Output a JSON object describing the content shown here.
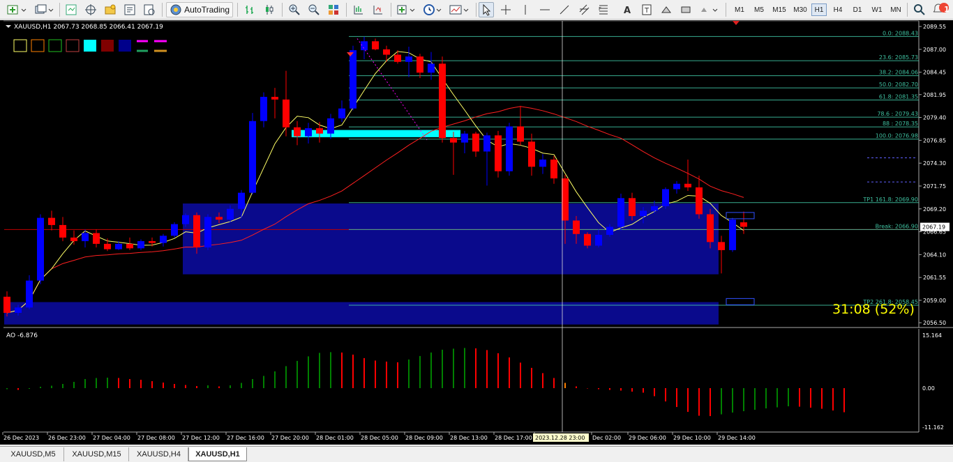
{
  "toolbar": {
    "autotrading_label": "AutoTrading",
    "timeframes": [
      "M1",
      "M5",
      "M15",
      "M30",
      "H1",
      "H4",
      "D1",
      "W1",
      "MN"
    ],
    "active_timeframe": "H1",
    "notification_count": "1"
  },
  "chart": {
    "header": "XAUUSD,H1  2067.73 2068.85 2066.41 2067.19",
    "current_price": "2067.19",
    "price_labels": [
      "2089.55",
      "2087.00",
      "2084.45",
      "2081.95",
      "2079.40",
      "2076.85",
      "2074.30",
      "2071.75",
      "2069.20",
      "2066.65",
      "2064.10",
      "2061.55",
      "2059.00",
      "2056.50"
    ],
    "fib_labels": [
      "0.0: 2088.43",
      "23.6: 2085.73",
      "38.2: 2084.06",
      "50.0: 2082.70",
      "61.8: 2081.35",
      "78.6 : 2079.43",
      "88 : 2078.35",
      "100.0: 2076.98",
      "TP1 161.8: 2069.90",
      "Break: 2066.90",
      "TP2 261.8: 2058.45"
    ],
    "countdown": "31:08 (52%)",
    "time_labels": [
      "26 Dec 2023",
      "26 Dec 23:00",
      "27 Dec 04:00",
      "27 Dec 08:00",
      "27 Dec 12:00",
      "27 Dec 16:00",
      "27 Dec 20:00",
      "28 Dec 01:00",
      "28 Dec 05:00",
      "28 Dec 09:00",
      "28 Dec 13:00",
      "28 Dec 17:00",
      "2023.12.28 23:00",
      "Dec 02:00",
      "29 Dec 06:00",
      "29 Dec 10:00",
      "29 Dec 14:00"
    ],
    "colors": {
      "bull": "#0000ff",
      "bear": "#ff0000",
      "zone": "#0a0a8c",
      "ma_fast": "#ffff66",
      "ma_slow": "#ff2020",
      "fib": "#3fc0a0",
      "cyan_zone": "#00ffff"
    },
    "candles": [
      {
        "o": 2059.4,
        "h": 2060.0,
        "l": 2057.2,
        "c": 2057.6
      },
      {
        "o": 2057.6,
        "h": 2058.5,
        "l": 2057.3,
        "c": 2058.2
      },
      {
        "o": 2058.2,
        "h": 2061.8,
        "l": 2058.0,
        "c": 2061.2
      },
      {
        "o": 2061.2,
        "h": 2068.6,
        "l": 2060.8,
        "c": 2068.2
      },
      {
        "o": 2068.2,
        "h": 2069.0,
        "l": 2066.8,
        "c": 2067.4
      },
      {
        "o": 2067.4,
        "h": 2068.3,
        "l": 2065.6,
        "c": 2066.0
      },
      {
        "o": 2066.0,
        "h": 2066.8,
        "l": 2065.2,
        "c": 2065.6
      },
      {
        "o": 2065.6,
        "h": 2066.9,
        "l": 2064.9,
        "c": 2066.5
      },
      {
        "o": 2066.5,
        "h": 2066.9,
        "l": 2064.9,
        "c": 2065.3
      },
      {
        "o": 2065.3,
        "h": 2065.9,
        "l": 2064.5,
        "c": 2064.7
      },
      {
        "o": 2064.7,
        "h": 2065.6,
        "l": 2064.6,
        "c": 2065.3
      },
      {
        "o": 2065.3,
        "h": 2066.0,
        "l": 2064.6,
        "c": 2064.8
      },
      {
        "o": 2064.8,
        "h": 2065.8,
        "l": 2064.6,
        "c": 2065.6
      },
      {
        "o": 2065.6,
        "h": 2066.0,
        "l": 2065.0,
        "c": 2065.4
      },
      {
        "o": 2065.4,
        "h": 2066.4,
        "l": 2065.0,
        "c": 2066.2
      },
      {
        "o": 2066.2,
        "h": 2067.7,
        "l": 2066.0,
        "c": 2067.5
      },
      {
        "o": 2067.5,
        "h": 2068.7,
        "l": 2067.2,
        "c": 2068.5
      },
      {
        "o": 2068.5,
        "h": 2068.8,
        "l": 2064.2,
        "c": 2064.9
      },
      {
        "o": 2064.9,
        "h": 2068.6,
        "l": 2064.6,
        "c": 2068.3
      },
      {
        "o": 2068.3,
        "h": 2068.8,
        "l": 2067.6,
        "c": 2068.0
      },
      {
        "o": 2068.0,
        "h": 2069.6,
        "l": 2067.7,
        "c": 2069.2
      },
      {
        "o": 2069.2,
        "h": 2071.3,
        "l": 2068.2,
        "c": 2071.0
      },
      {
        "o": 2071.0,
        "h": 2079.9,
        "l": 2070.8,
        "c": 2079.0
      },
      {
        "o": 2079.0,
        "h": 2082.2,
        "l": 2078.3,
        "c": 2081.7
      },
      {
        "o": 2081.7,
        "h": 2082.7,
        "l": 2079.3,
        "c": 2081.4
      },
      {
        "o": 2081.4,
        "h": 2084.6,
        "l": 2077.3,
        "c": 2078.3
      },
      {
        "o": 2078.3,
        "h": 2079.0,
        "l": 2076.3,
        "c": 2077.3
      },
      {
        "o": 2077.3,
        "h": 2078.8,
        "l": 2076.5,
        "c": 2078.2
      },
      {
        "o": 2078.2,
        "h": 2078.9,
        "l": 2076.6,
        "c": 2077.6
      },
      {
        "o": 2077.6,
        "h": 2079.8,
        "l": 2077.0,
        "c": 2079.3
      },
      {
        "o": 2079.3,
        "h": 2081.3,
        "l": 2078.9,
        "c": 2080.4
      },
      {
        "o": 2080.4,
        "h": 2087.4,
        "l": 2080.2,
        "c": 2086.9
      },
      {
        "o": 2086.9,
        "h": 2088.4,
        "l": 2085.9,
        "c": 2087.9
      },
      {
        "o": 2087.9,
        "h": 2088.2,
        "l": 2086.9,
        "c": 2087.0
      },
      {
        "o": 2087.0,
        "h": 2087.4,
        "l": 2085.6,
        "c": 2086.4
      },
      {
        "o": 2086.4,
        "h": 2086.9,
        "l": 2085.4,
        "c": 2085.6
      },
      {
        "o": 2085.6,
        "h": 2087.3,
        "l": 2083.9,
        "c": 2086.2
      },
      {
        "o": 2086.2,
        "h": 2086.5,
        "l": 2083.8,
        "c": 2084.4
      },
      {
        "o": 2084.4,
        "h": 2086.7,
        "l": 2083.6,
        "c": 2085.4
      },
      {
        "o": 2085.4,
        "h": 2086.2,
        "l": 2076.6,
        "c": 2077.1
      },
      {
        "o": 2077.1,
        "h": 2077.8,
        "l": 2073.0,
        "c": 2076.6
      },
      {
        "o": 2076.6,
        "h": 2077.9,
        "l": 2075.4,
        "c": 2077.6
      },
      {
        "o": 2077.6,
        "h": 2077.8,
        "l": 2075.0,
        "c": 2075.6
      },
      {
        "o": 2075.6,
        "h": 2077.7,
        "l": 2071.8,
        "c": 2077.4
      },
      {
        "o": 2077.4,
        "h": 2077.9,
        "l": 2072.7,
        "c": 2073.4
      },
      {
        "o": 2073.4,
        "h": 2078.8,
        "l": 2072.9,
        "c": 2078.4
      },
      {
        "o": 2078.4,
        "h": 2080.7,
        "l": 2076.3,
        "c": 2076.7
      },
      {
        "o": 2076.7,
        "h": 2077.6,
        "l": 2072.9,
        "c": 2073.9
      },
      {
        "o": 2073.9,
        "h": 2075.3,
        "l": 2073.1,
        "c": 2074.7
      },
      {
        "o": 2074.7,
        "h": 2075.1,
        "l": 2072.0,
        "c": 2072.6
      },
      {
        "o": 2072.6,
        "h": 2073.0,
        "l": 2065.3,
        "c": 2067.9
      },
      {
        "o": 2067.9,
        "h": 2068.4,
        "l": 2065.3,
        "c": 2066.4
      },
      {
        "o": 2066.4,
        "h": 2066.6,
        "l": 2064.8,
        "c": 2065.1
      },
      {
        "o": 2065.1,
        "h": 2066.9,
        "l": 2064.9,
        "c": 2066.3
      },
      {
        "o": 2066.3,
        "h": 2067.5,
        "l": 2066.1,
        "c": 2067.2
      },
      {
        "o": 2067.2,
        "h": 2070.9,
        "l": 2066.8,
        "c": 2070.4
      },
      {
        "o": 2070.4,
        "h": 2071.0,
        "l": 2067.9,
        "c": 2068.4
      },
      {
        "o": 2068.4,
        "h": 2069.4,
        "l": 2067.6,
        "c": 2069.0
      },
      {
        "o": 2069.0,
        "h": 2070.1,
        "l": 2068.7,
        "c": 2069.5
      },
      {
        "o": 2069.5,
        "h": 2071.6,
        "l": 2069.2,
        "c": 2071.4
      },
      {
        "o": 2071.4,
        "h": 2072.3,
        "l": 2070.9,
        "c": 2072.0
      },
      {
        "o": 2072.0,
        "h": 2074.7,
        "l": 2071.2,
        "c": 2071.6
      },
      {
        "o": 2071.6,
        "h": 2072.9,
        "l": 2068.1,
        "c": 2068.6
      },
      {
        "o": 2068.6,
        "h": 2069.2,
        "l": 2064.8,
        "c": 2065.5
      },
      {
        "o": 2065.5,
        "h": 2066.2,
        "l": 2062.0,
        "c": 2064.6
      },
      {
        "o": 2064.6,
        "h": 2068.2,
        "l": 2064.4,
        "c": 2068.0
      },
      {
        "o": 2067.7,
        "h": 2068.9,
        "l": 2066.4,
        "c": 2067.2
      }
    ],
    "ao_values": [
      -0.3,
      -0.5,
      -0.2,
      0.4,
      0.7,
      1.2,
      1.8,
      2.6,
      2.9,
      3.0,
      2.9,
      2.6,
      2.4,
      2.0,
      1.6,
      1.2,
      0.9,
      0.6,
      0.8,
      0.5,
      0.8,
      1.5,
      2.6,
      3.5,
      4.8,
      6.3,
      7.8,
      9.1,
      10.1,
      10.3,
      10.2,
      9.6,
      8.6,
      7.9,
      7.6,
      7.4,
      8.2,
      9.2,
      10.2,
      11.0,
      11.3,
      11.5,
      11.4,
      10.9,
      10.0,
      8.8,
      7.3,
      5.8,
      4.3,
      2.9,
      1.5,
      0.5,
      -0.1,
      -0.3,
      -0.5,
      -0.7,
      -1.0,
      -1.3,
      -2.3,
      -3.8,
      -5.4,
      -6.8,
      -7.9,
      -8.0,
      -7.5,
      -7.0,
      -6.6,
      -6.2,
      -5.8,
      -5.5,
      -5.2,
      -5.3,
      -5.6,
      -5.9,
      -6.4,
      -6.9
    ],
    "ao_label": "AO -6.876",
    "ao_axis": [
      "15.164",
      "0.00",
      "-11.162"
    ]
  },
  "tabs": [
    "XAUUSD,M5",
    "XAUUSD,M15",
    "XAUUSD,H4",
    "XAUUSD,H1"
  ],
  "active_tab": "XAUUSD,H1"
}
